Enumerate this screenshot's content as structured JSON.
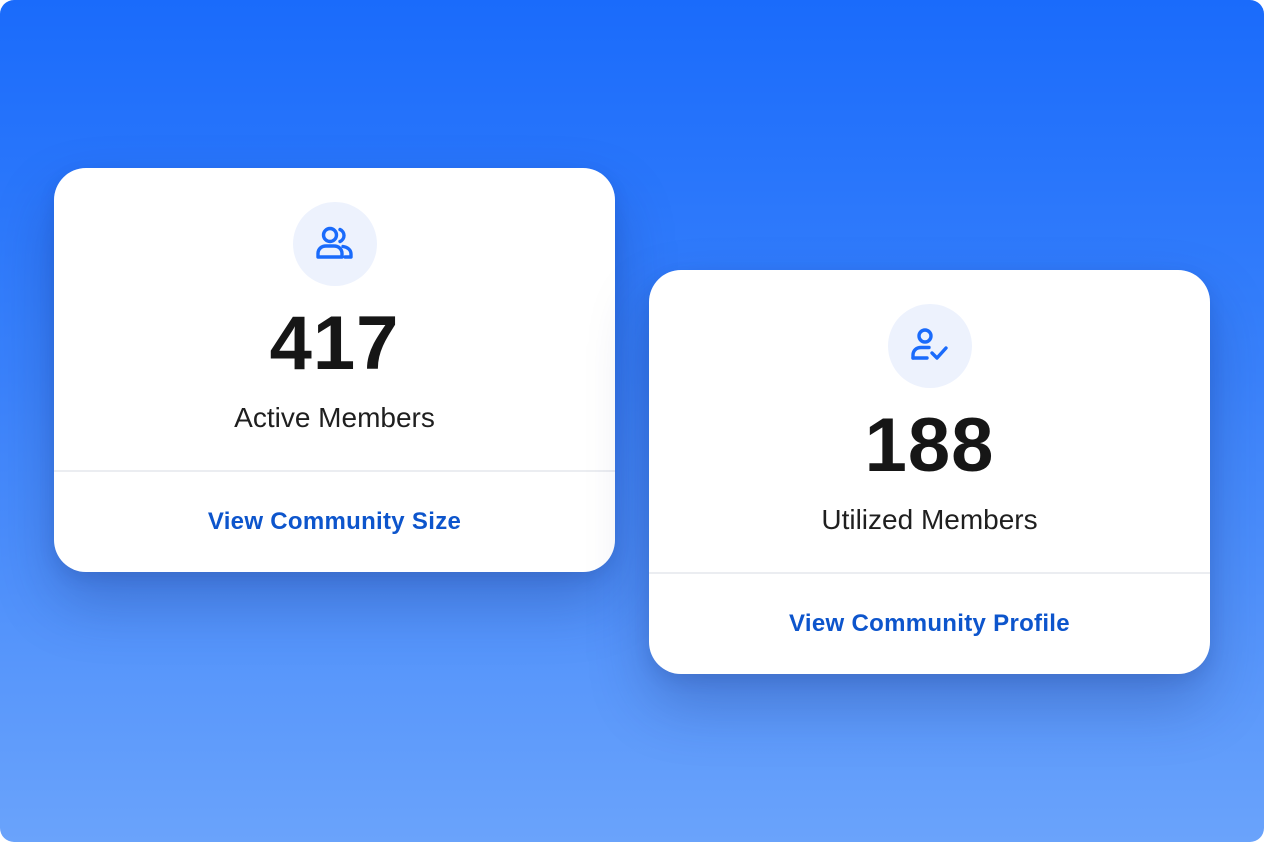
{
  "colors": {
    "background_top": "#1a6bfb",
    "background_bottom": "#6aa3fb",
    "card": "#ffffff",
    "icon_circle": "#edf2fd",
    "icon": "#1a6bfb",
    "link": "#0d55cc",
    "value_text": "#161616"
  },
  "cards": [
    {
      "icon": "users-group-icon",
      "value": "417",
      "label": "Active Members",
      "link": "View Community Size"
    },
    {
      "icon": "user-check-icon",
      "value": "188",
      "label": "Utilized Members",
      "link": "View Community Profile"
    }
  ]
}
